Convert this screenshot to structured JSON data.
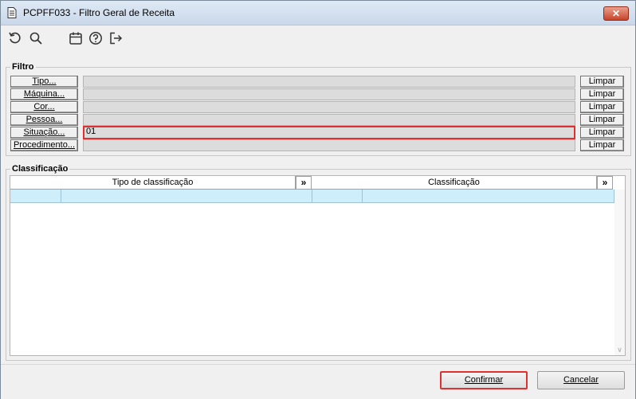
{
  "window": {
    "title": "PCPFF033 - Filtro Geral de Receita",
    "close_label": "✕"
  },
  "toolbar": {
    "icons": [
      "undo-icon",
      "search-icon",
      "calendar-icon",
      "help-icon",
      "exit-icon"
    ]
  },
  "filtro": {
    "label": "Filtro",
    "rows": [
      {
        "button": "Tipo...",
        "value": "",
        "clear": "Limpar"
      },
      {
        "button": "Máquina...",
        "value": "",
        "clear": "Limpar"
      },
      {
        "button": "Cor...",
        "value": "",
        "clear": "Limpar"
      },
      {
        "button": "Pessoa...",
        "value": "",
        "clear": "Limpar"
      },
      {
        "button": "Situação...",
        "value": "01",
        "clear": "Limpar"
      },
      {
        "button": "Procedimento...",
        "value": "",
        "clear": "Limpar"
      }
    ]
  },
  "classificacao": {
    "label": "Classificação",
    "columns": [
      "Tipo de classificação",
      "Classificação"
    ],
    "expand_label": "»"
  },
  "footer": {
    "confirm": "Confirmar",
    "cancel": "Cancelar"
  },
  "colors": {
    "highlight": "#e03030",
    "selected_row": "#cfeefb",
    "close": "#c7442a"
  }
}
